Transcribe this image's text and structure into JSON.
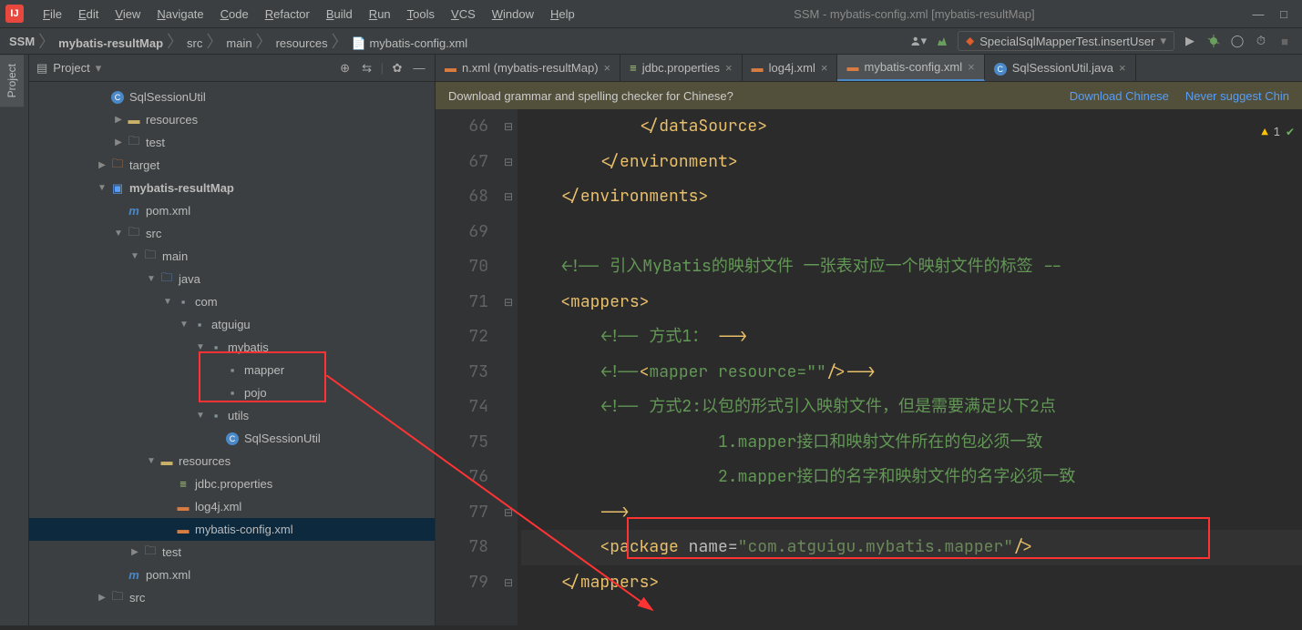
{
  "menubar": {
    "items": [
      "File",
      "Edit",
      "View",
      "Navigate",
      "Code",
      "Refactor",
      "Build",
      "Run",
      "Tools",
      "VCS",
      "Window",
      "Help"
    ],
    "title": "SSM - mybatis-config.xml [mybatis-resultMap]"
  },
  "breadcrumb": {
    "root": "SSM",
    "parts": [
      "mybatis-resultMap",
      "src",
      "main",
      "resources",
      "mybatis-config.xml"
    ]
  },
  "runconfig": {
    "name": "SpecialSqlMapperTest.insertUser"
  },
  "project": {
    "label": "Project",
    "tree": [
      {
        "depth": 0,
        "name": "SqlSessionUtil",
        "icon": "class",
        "arrow": ""
      },
      {
        "depth": 1,
        "name": "resources",
        "icon": "resfolder",
        "arrow": "▶"
      },
      {
        "depth": 1,
        "name": "test",
        "icon": "folder",
        "arrow": "▶"
      },
      {
        "depth": 0,
        "name": "target",
        "icon": "ofolder",
        "arrow": "▶"
      },
      {
        "depth": 0,
        "name": "mybatis-resultMap",
        "icon": "module",
        "arrow": "▼",
        "bold": true
      },
      {
        "depth": 1,
        "name": "pom.xml",
        "icon": "maven",
        "arrow": ""
      },
      {
        "depth": 1,
        "name": "src",
        "icon": "folder",
        "arrow": "▼"
      },
      {
        "depth": 2,
        "name": "main",
        "icon": "folder",
        "arrow": "▼"
      },
      {
        "depth": 3,
        "name": "java",
        "icon": "bluefolder",
        "arrow": "▼"
      },
      {
        "depth": 4,
        "name": "com",
        "icon": "graypkg",
        "arrow": "▼"
      },
      {
        "depth": 5,
        "name": "atguigu",
        "icon": "graypkg",
        "arrow": "▼"
      },
      {
        "depth": 6,
        "name": "mybatis",
        "icon": "graypkg",
        "arrow": "▼"
      },
      {
        "depth": 7,
        "name": "mapper",
        "icon": "graypkg",
        "arrow": ""
      },
      {
        "depth": 7,
        "name": "pojo",
        "icon": "graypkg",
        "arrow": ""
      },
      {
        "depth": 6,
        "name": "utils",
        "icon": "graypkg",
        "arrow": "▼"
      },
      {
        "depth": 7,
        "name": "SqlSessionUtil",
        "icon": "class",
        "arrow": ""
      },
      {
        "depth": 3,
        "name": "resources",
        "icon": "resfolder",
        "arrow": "▼"
      },
      {
        "depth": 4,
        "name": "jdbc.properties",
        "icon": "prop",
        "arrow": ""
      },
      {
        "depth": 4,
        "name": "log4j.xml",
        "icon": "xml",
        "arrow": ""
      },
      {
        "depth": 4,
        "name": "mybatis-config.xml",
        "icon": "xml",
        "arrow": "",
        "selected": true
      },
      {
        "depth": 2,
        "name": "test",
        "icon": "folder",
        "arrow": "▶"
      },
      {
        "depth": 1,
        "name": "pom.xml",
        "icon": "maven",
        "arrow": ""
      },
      {
        "depth": 0,
        "name": "src",
        "icon": "folder",
        "arrow": "▶"
      }
    ]
  },
  "tabs": [
    {
      "label": "n.xml (mybatis-resultMap)",
      "icon": "xml",
      "active": false
    },
    {
      "label": "jdbc.properties",
      "icon": "prop",
      "active": false
    },
    {
      "label": "log4j.xml",
      "icon": "xml",
      "active": false
    },
    {
      "label": "mybatis-config.xml",
      "icon": "xml",
      "active": true
    },
    {
      "label": "SqlSessionUtil.java",
      "icon": "class",
      "active": false
    }
  ],
  "banner": {
    "text": "Download grammar and spelling checker for Chinese?",
    "link1": "Download Chinese",
    "link2": "Never suggest Chin"
  },
  "code": {
    "startLine": 66,
    "lines": [
      {
        "n": 66,
        "html": "            </<t>dataSource</t>>"
      },
      {
        "n": 67,
        "html": "        </<t>environment</t>>"
      },
      {
        "n": 68,
        "html": "    </<t>environments</t>>"
      },
      {
        "n": 69,
        "html": ""
      },
      {
        "n": 70,
        "html": "    <c><!-- 引入MyBatis的映射文件 一张表对应一个映射文件的标签 --</c>"
      },
      {
        "n": 71,
        "html": "    <<t>mappers</t>>"
      },
      {
        "n": 72,
        "html": "        <c><!-- 方式1： --></c>"
      },
      {
        "n": 73,
        "html": "        <c><!--<mapper resource=\"\"/>--></c>"
      },
      {
        "n": 74,
        "html": "        <c><!-- 方式2:以包的形式引入映射文件，但是需要满足以下2点</c>"
      },
      {
        "n": 75,
        "html": "                    <c>1.mapper接口和映射文件所在的包必须一致</c>"
      },
      {
        "n": 76,
        "html": "                    <c>2.mapper接口的名字和映射文件的名字必须一致</c>"
      },
      {
        "n": 77,
        "html": "        <c>--></c>"
      },
      {
        "n": 78,
        "html": "        <<t>package</t> <a>name</a>=<s>\"com.atguigu.mybatis.mapper\"</s>/>",
        "hl": true
      },
      {
        "n": 79,
        "html": "    </<t>mappers</t>>"
      }
    ]
  },
  "errors": {
    "y": "1"
  }
}
